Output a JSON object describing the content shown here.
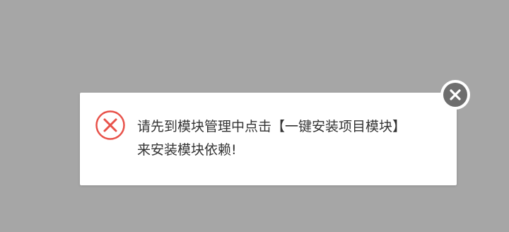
{
  "dialog": {
    "message_line1": "请先到模块管理中点击【一键安装项目模块】",
    "message_line2": "来安装模块依赖!",
    "icon": "error-x-circle-icon",
    "close_icon": "close-icon"
  },
  "colors": {
    "backdrop": "#a6a6a6",
    "dialog_bg": "#ffffff",
    "error_red": "#e8524a",
    "close_bg": "#6e6e6e",
    "text": "#333333"
  }
}
